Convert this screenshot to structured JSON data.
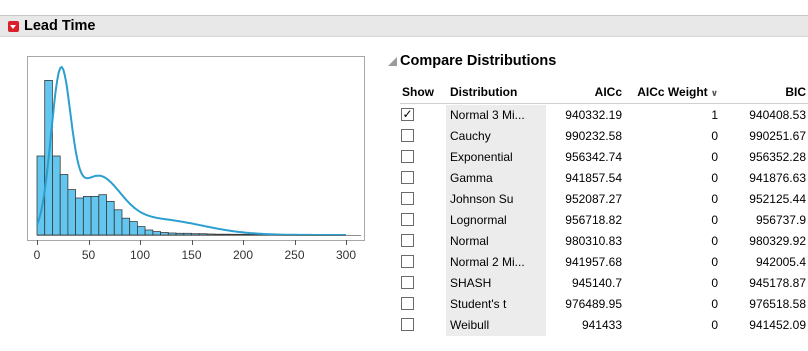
{
  "outline": {
    "title": "Lead Time",
    "disclosure_icon": "red-disclosure-triangle"
  },
  "histogram": {
    "x_ticks": [
      "0",
      "50",
      "100",
      "150",
      "200",
      "250",
      "300"
    ],
    "x_tick_values": [
      0,
      50,
      100,
      150,
      200,
      250,
      300
    ],
    "x_range": [
      -10,
      310
    ],
    "bin_width": 7.5,
    "bar_heights": [
      0.47,
      0.92,
      0.47,
      0.36,
      0.27,
      0.22,
      0.23,
      0.23,
      0.24,
      0.2,
      0.15,
      0.1,
      0.08,
      0.05,
      0.03,
      0.02,
      0.015,
      0.012,
      0.01,
      0.01,
      0.008,
      0.008,
      0.006,
      0.005,
      0.005,
      0.004,
      0.004,
      0.004,
      0.003,
      0.003
    ],
    "bar_color": "#62c6ee",
    "curve_color": "#2a9fd0"
  },
  "compare": {
    "title": "Compare Distributions",
    "columns": {
      "show": "Show",
      "distribution": "Distribution",
      "aicc": "AICc",
      "aicc_weight": "AICc Weight",
      "bic": "BIC"
    },
    "rows": [
      {
        "checked": true,
        "distribution": "Normal 3 Mi...",
        "aicc": "940332.19",
        "aicc_weight": "1",
        "bic": "940408.53"
      },
      {
        "checked": false,
        "distribution": "Cauchy",
        "aicc": "990232.58",
        "aicc_weight": "0",
        "bic": "990251.67"
      },
      {
        "checked": false,
        "distribution": "Exponential",
        "aicc": "956342.74",
        "aicc_weight": "0",
        "bic": "956352.28"
      },
      {
        "checked": false,
        "distribution": "Gamma",
        "aicc": "941857.54",
        "aicc_weight": "0",
        "bic": "941876.63"
      },
      {
        "checked": false,
        "distribution": "Johnson Su",
        "aicc": "952087.27",
        "aicc_weight": "0",
        "bic": "952125.44"
      },
      {
        "checked": false,
        "distribution": "Lognormal",
        "aicc": "956718.82",
        "aicc_weight": "0",
        "bic": "956737.9"
      },
      {
        "checked": false,
        "distribution": "Normal",
        "aicc": "980310.83",
        "aicc_weight": "0",
        "bic": "980329.92"
      },
      {
        "checked": false,
        "distribution": "Normal 2 Mi...",
        "aicc": "941957.68",
        "aicc_weight": "0",
        "bic": "942005.4"
      },
      {
        "checked": false,
        "distribution": "SHASH",
        "aicc": "945140.7",
        "aicc_weight": "0",
        "bic": "945178.87"
      },
      {
        "checked": false,
        "distribution": "Student's t",
        "aicc": "976489.95",
        "aicc_weight": "0",
        "bic": "976518.58"
      },
      {
        "checked": false,
        "distribution": "Weibull",
        "aicc": "941433",
        "aicc_weight": "0",
        "bic": "941452.09"
      }
    ]
  }
}
